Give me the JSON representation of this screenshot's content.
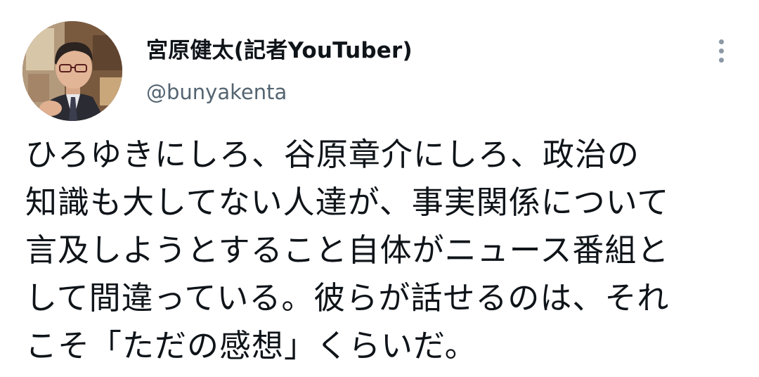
{
  "author": {
    "display_name": "宮原健太(記者YouTuber)",
    "handle": "@bunyakenta"
  },
  "tweet": {
    "lines": [
      "ひろゆきにしろ、谷原章介にしろ、政治の",
      "知識も大してない人達が、事実関係について",
      "言及しようとすること自体がニュース番組と",
      "して間違っている。彼らが話せるのは、それ",
      "こそ「ただの感想」くらいだ。"
    ]
  },
  "icons": {
    "more": "more-vertical-icon",
    "avatar": "profile-photo"
  },
  "colors": {
    "text_primary": "#0f1419",
    "text_secondary": "#536471",
    "icon_gray": "#8b98a5",
    "background": "#ffffff"
  }
}
